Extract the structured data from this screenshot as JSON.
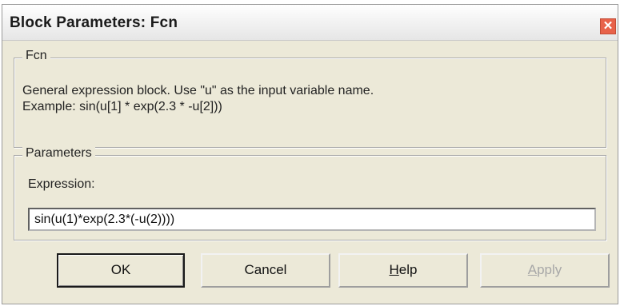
{
  "window": {
    "title": "Block Parameters: Fcn",
    "close_glyph": "✕"
  },
  "fcn_group": {
    "legend": "Fcn",
    "line1": "General expression block. Use \"u\" as the input variable name.",
    "line2": "Example: sin(u[1] * exp(2.3 * -u[2]))"
  },
  "parameters_group": {
    "legend": "Parameters",
    "expression_label": "Expression:",
    "expression_value": "sin(u(1)*exp(2.3*(-u(2))))"
  },
  "buttons": {
    "ok": "OK",
    "cancel": "Cancel",
    "help_underlined": "H",
    "help_rest": "elp",
    "apply_underlined": "A",
    "apply_rest": "pply"
  }
}
